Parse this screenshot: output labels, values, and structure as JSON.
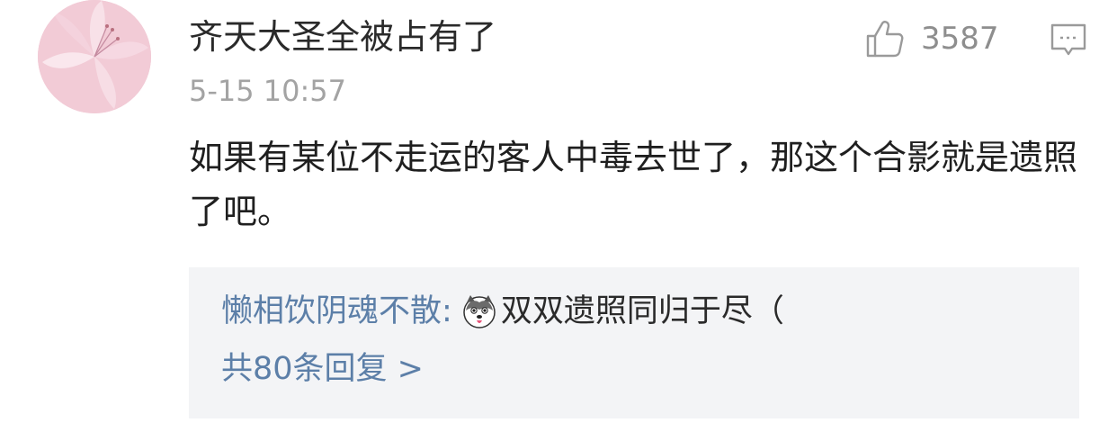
{
  "comment": {
    "avatar_icon": "lily-flower-avatar",
    "username": "齐天大圣全被占有了",
    "timestamp": "5-15 10:57",
    "like_icon": "thumbs-up-icon",
    "like_count": "3587",
    "reply_icon": "comment-bubble-icon",
    "text": "如果有某位不走运的客人中毒去世了，那这个合影就是遗照了吧。",
    "replies": {
      "first_reply": {
        "author": "懒相饮阴魂不散",
        "colon": ":",
        "emoji_icon": "husky-dog-emoji-icon",
        "text": "双双遗照同归于尽（"
      },
      "more_label": "共80条回复 >"
    }
  },
  "colors": {
    "link_blue": "#5c7fa8",
    "timestamp_gray": "#a3a3a3",
    "reply_box_bg": "#f3f4f6"
  }
}
